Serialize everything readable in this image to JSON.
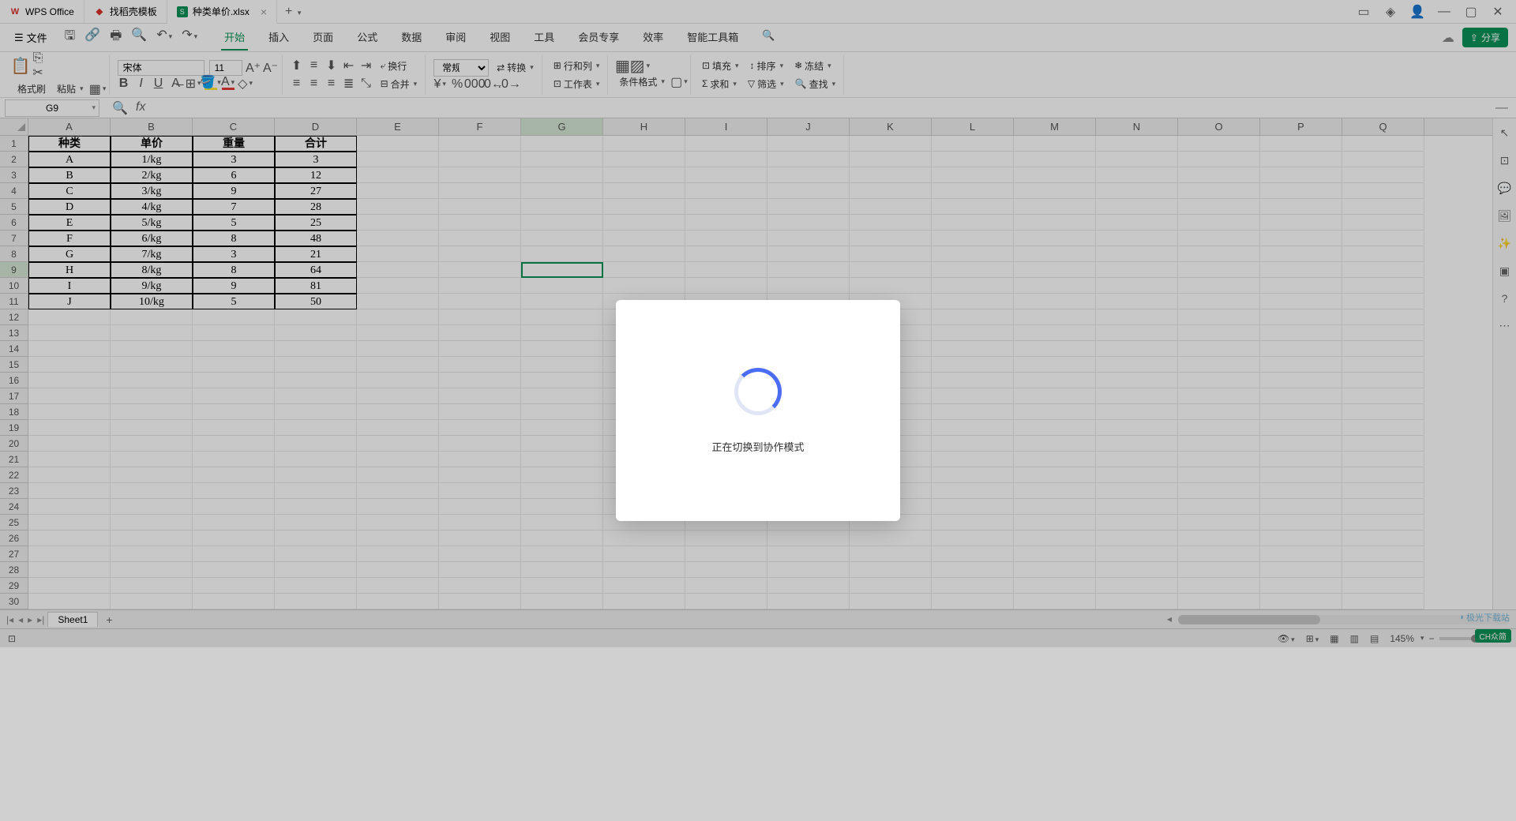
{
  "titlebar": {
    "tabs": [
      {
        "icon": "W",
        "label": "WPS Office",
        "color": "#d9302c"
      },
      {
        "icon": "D",
        "label": "找稻壳模板",
        "color": "#d9302c"
      },
      {
        "icon": "S",
        "label": "种类单价.xlsx",
        "color": "#0a9458",
        "active": true
      }
    ]
  },
  "menu": {
    "file": "文件",
    "tabs": [
      "开始",
      "插入",
      "页面",
      "公式",
      "数据",
      "审阅",
      "视图",
      "工具",
      "会员专享",
      "效率",
      "智能工具箱"
    ],
    "active_tab": 0,
    "share": "分享"
  },
  "ribbon": {
    "format_brush": "格式刷",
    "paste": "粘贴",
    "font_name": "宋体",
    "font_size": "11",
    "wrap": "换行",
    "merge": "合并",
    "number_format": "常规",
    "convert": "转换",
    "rowcol": "行和列",
    "worksheet": "工作表",
    "cond_format": "条件格式",
    "fill": "填充",
    "sort": "排序",
    "freeze": "冻结",
    "sum": "求和",
    "filter": "筛选",
    "find": "查找"
  },
  "formula": {
    "cell_ref": "G9",
    "fx": "fx"
  },
  "grid": {
    "columns": [
      "A",
      "B",
      "C",
      "D",
      "E",
      "F",
      "G",
      "H",
      "I",
      "J",
      "K",
      "L",
      "M",
      "N",
      "O",
      "P",
      "Q"
    ],
    "selected_col": "G",
    "selected_row": 9,
    "visible_rows": 30,
    "headers": [
      "种类",
      "单价",
      "重量",
      "合计"
    ],
    "data": [
      [
        "A",
        "1/kg",
        "3",
        "3"
      ],
      [
        "B",
        "2/kg",
        "6",
        "12"
      ],
      [
        "C",
        "3/kg",
        "9",
        "27"
      ],
      [
        "D",
        "4/kg",
        "7",
        "28"
      ],
      [
        "E",
        "5/kg",
        "5",
        "25"
      ],
      [
        "F",
        "6/kg",
        "8",
        "48"
      ],
      [
        "G",
        "7/kg",
        "3",
        "21"
      ],
      [
        "H",
        "8/kg",
        "8",
        "64"
      ],
      [
        "I",
        "9/kg",
        "9",
        "81"
      ],
      [
        "J",
        "10/kg",
        "5",
        "50"
      ]
    ]
  },
  "sheet": {
    "name": "Sheet1"
  },
  "status": {
    "zoom": "145%"
  },
  "modal": {
    "text": "正在切换到协作模式"
  },
  "watermark": "极光下载站",
  "badge": "CH众简"
}
